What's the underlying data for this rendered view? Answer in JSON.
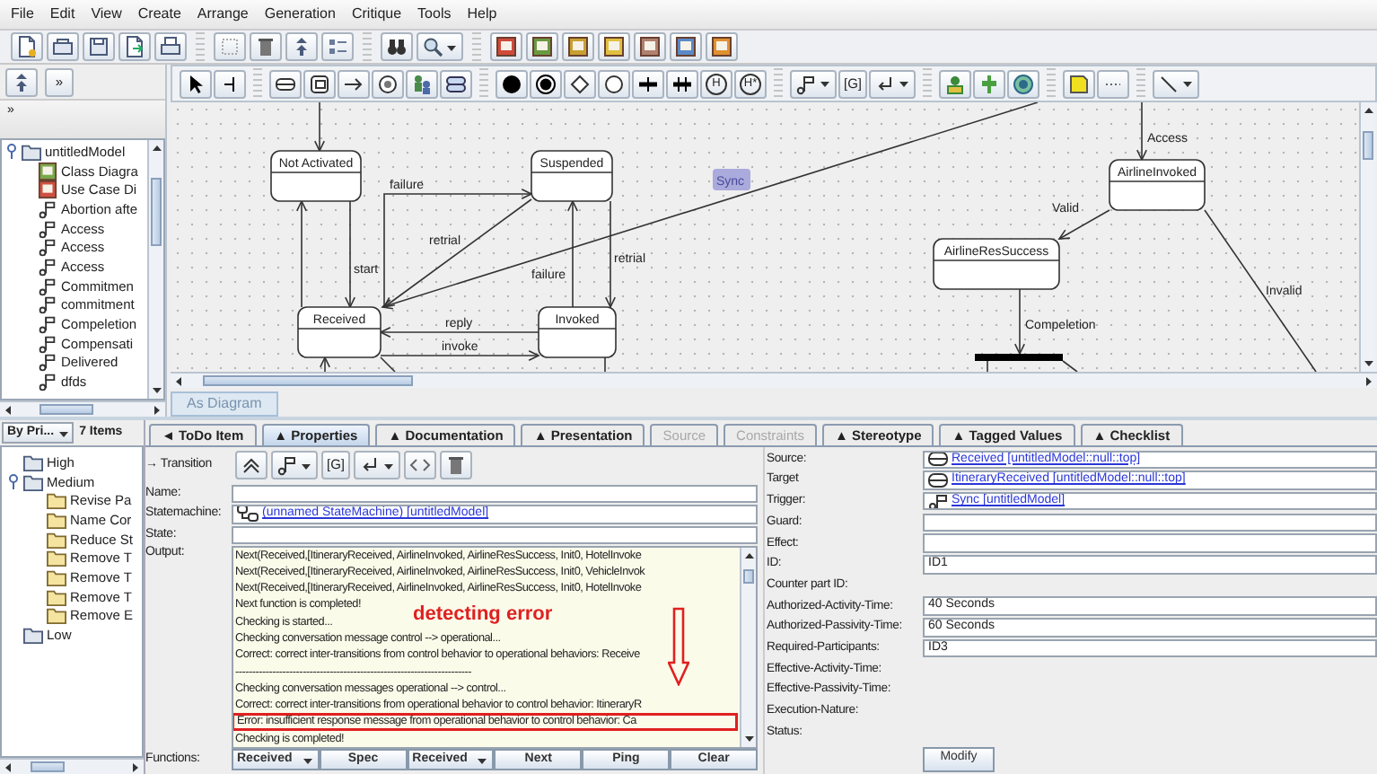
{
  "menu": [
    "File",
    "Edit",
    "View",
    "Create",
    "Arrange",
    "Generation",
    "Critique",
    "Tools",
    "Help"
  ],
  "explorer": {
    "more_button": "»",
    "more_label": "»",
    "tree": [
      {
        "label": "untitledModel",
        "kind": "model",
        "expanded": true,
        "children": [
          {
            "label": "Class Diagra",
            "kind": "class-diagram"
          },
          {
            "label": "Use Case Di",
            "kind": "usecase-diagram"
          },
          {
            "label": "Abortion afte",
            "kind": "event"
          },
          {
            "label": "Access",
            "kind": "event"
          },
          {
            "label": "Access",
            "kind": "event"
          },
          {
            "label": "Access",
            "kind": "event"
          },
          {
            "label": "Commitmen",
            "kind": "event"
          },
          {
            "label": "commitment",
            "kind": "event"
          },
          {
            "label": "Compeletion",
            "kind": "event"
          },
          {
            "label": "Compensati",
            "kind": "event"
          },
          {
            "label": "Delivered",
            "kind": "event"
          },
          {
            "label": "dfds",
            "kind": "event"
          }
        ]
      }
    ]
  },
  "diagram": {
    "toolbar": {
      "history": "H",
      "deep_history": "H*",
      "guard": "[G]"
    },
    "states": [
      {
        "name": "Not Activated"
      },
      {
        "name": "Suspended"
      },
      {
        "name": "Received"
      },
      {
        "name": "Invoked"
      },
      {
        "name": "AirlineInvoked"
      },
      {
        "name": "AirlineResSuccess"
      }
    ],
    "transitions": [
      {
        "label": "failure"
      },
      {
        "label": "retrial"
      },
      {
        "label": "start"
      },
      {
        "label": "failure"
      },
      {
        "label": "retrial"
      },
      {
        "label": "reply"
      },
      {
        "label": "invoke"
      },
      {
        "label": "Access"
      },
      {
        "label": "Valid"
      },
      {
        "label": "Compeletion"
      },
      {
        "label": "Invalid"
      }
    ],
    "sync": {
      "label": "Sync",
      "selected": true
    },
    "tab": "As Diagram"
  },
  "todo": {
    "sort": "By Pri...",
    "count": "7 Items",
    "tree": [
      {
        "label": "High",
        "expanded": false
      },
      {
        "label": "Medium",
        "expanded": true,
        "children": [
          {
            "label": "Revise Pa"
          },
          {
            "label": "Name Cor"
          },
          {
            "label": "Reduce St"
          },
          {
            "label": "Remove T"
          },
          {
            "label": "Remove T"
          },
          {
            "label": "Remove T"
          },
          {
            "label": "Remove E"
          }
        ]
      },
      {
        "label": "Low",
        "expanded": false
      }
    ]
  },
  "details": {
    "tabs": [
      {
        "label": "◄ ToDo Item",
        "selected": false,
        "disabled": false
      },
      {
        "label": "▲ Properties",
        "selected": true,
        "disabled": false
      },
      {
        "label": "▲ Documentation",
        "selected": false,
        "disabled": false
      },
      {
        "label": "▲ Presentation",
        "selected": false,
        "disabled": false
      },
      {
        "label": "Source",
        "selected": false,
        "disabled": true
      },
      {
        "label": "Constraints",
        "selected": false,
        "disabled": true
      },
      {
        "label": "▲ Stereotype",
        "selected": false,
        "disabled": false
      },
      {
        "label": "▲ Tagged Values",
        "selected": false,
        "disabled": false
      },
      {
        "label": "▲ Checklist",
        "selected": false,
        "disabled": false
      }
    ],
    "element": "→ Transition",
    "toolbar": {
      "guard": "[G]"
    },
    "fields": [
      {
        "label": "Name:",
        "kind": "field"
      },
      {
        "label": "Statemachine:",
        "kind": "link",
        "value": "(unnamed StateMachine) [untitledModel]"
      },
      {
        "label": "State:",
        "kind": "field"
      },
      {
        "label": "Output:",
        "kind": "output",
        "lines": [
          {
            "text": "Next(Received,[ItineraryReceived, AirlineInvoked, AirlineResSuccess, Init0, HotelInvoke",
            "highlighted": false
          },
          {
            "text": "Next(Received,[ItineraryReceived, AirlineInvoked, AirlineResSuccess, Init0, VehicleInvok",
            "highlighted": false
          },
          {
            "text": "Next(Received,[ItineraryReceived, AirlineInvoked, AirlineResSuccess, Init0, HotelInvoke",
            "highlighted": false
          },
          {
            "text": "Next function is completed!",
            "highlighted": false
          },
          {
            "text": "Checking is started...",
            "highlighted": false
          },
          {
            "text": "Checking conversation message control --> operational...",
            "highlighted": false
          },
          {
            "text": "Correct: correct inter-transitions from control behavior to operational behaviors: Receive",
            "highlighted": false
          },
          {
            "text": "----------------------------------------------------------------------",
            "highlighted": false
          },
          {
            "text": "Checking conversation messages operational --> control...",
            "highlighted": false
          },
          {
            "text": "Correct: correct inter-transitions from operational behavior to control behavior: ItineraryR",
            "highlighted": false
          },
          {
            "text": "Error: insufficient response message from operational behavior to control behavior: Ca",
            "highlighted": true
          },
          {
            "text": "Checking is completed!",
            "highlighted": false
          }
        ]
      }
    ],
    "annotation": "detecting error",
    "functions": {
      "label": "Functions:",
      "controls": [
        {
          "kind": "combo",
          "text": "Received"
        },
        {
          "kind": "button",
          "text": "Spec"
        },
        {
          "kind": "combo",
          "text": "Received"
        },
        {
          "kind": "button",
          "text": "Next"
        },
        {
          "kind": "button",
          "text": "Ping"
        },
        {
          "kind": "button",
          "text": "Clear"
        }
      ]
    },
    "properties": [
      {
        "label": "Source:",
        "kind": "state-link",
        "value": "Received [untitledModel::null::top]"
      },
      {
        "label": "Target",
        "kind": "state-link",
        "value": "ItineraryReceived [untitledModel::null::top]"
      },
      {
        "label": "Trigger:",
        "kind": "event-link",
        "value": "Sync [untitledModel]"
      },
      {
        "label": "Guard:",
        "kind": "field"
      },
      {
        "label": "Effect:",
        "kind": "field"
      },
      {
        "label": "ID:",
        "kind": "field",
        "value": "ID1"
      },
      {
        "label": "Counter part ID:",
        "kind": "text"
      },
      {
        "label": "Authorized-Activity-Time:",
        "kind": "field",
        "value": "40 Seconds"
      },
      {
        "label": "Authorized-Passivity-Time:",
        "kind": "field",
        "value": "60 Seconds"
      },
      {
        "label": "Required-Participants:",
        "kind": "field",
        "value": "ID3"
      },
      {
        "label": "Effective-Activity-Time:",
        "kind": "text"
      },
      {
        "label": "Effective-Passivity-Time:",
        "kind": "text"
      },
      {
        "label": "Execution-Nature:",
        "kind": "text"
      },
      {
        "label": "Status:",
        "kind": "text"
      }
    ],
    "modify": "Modify"
  }
}
